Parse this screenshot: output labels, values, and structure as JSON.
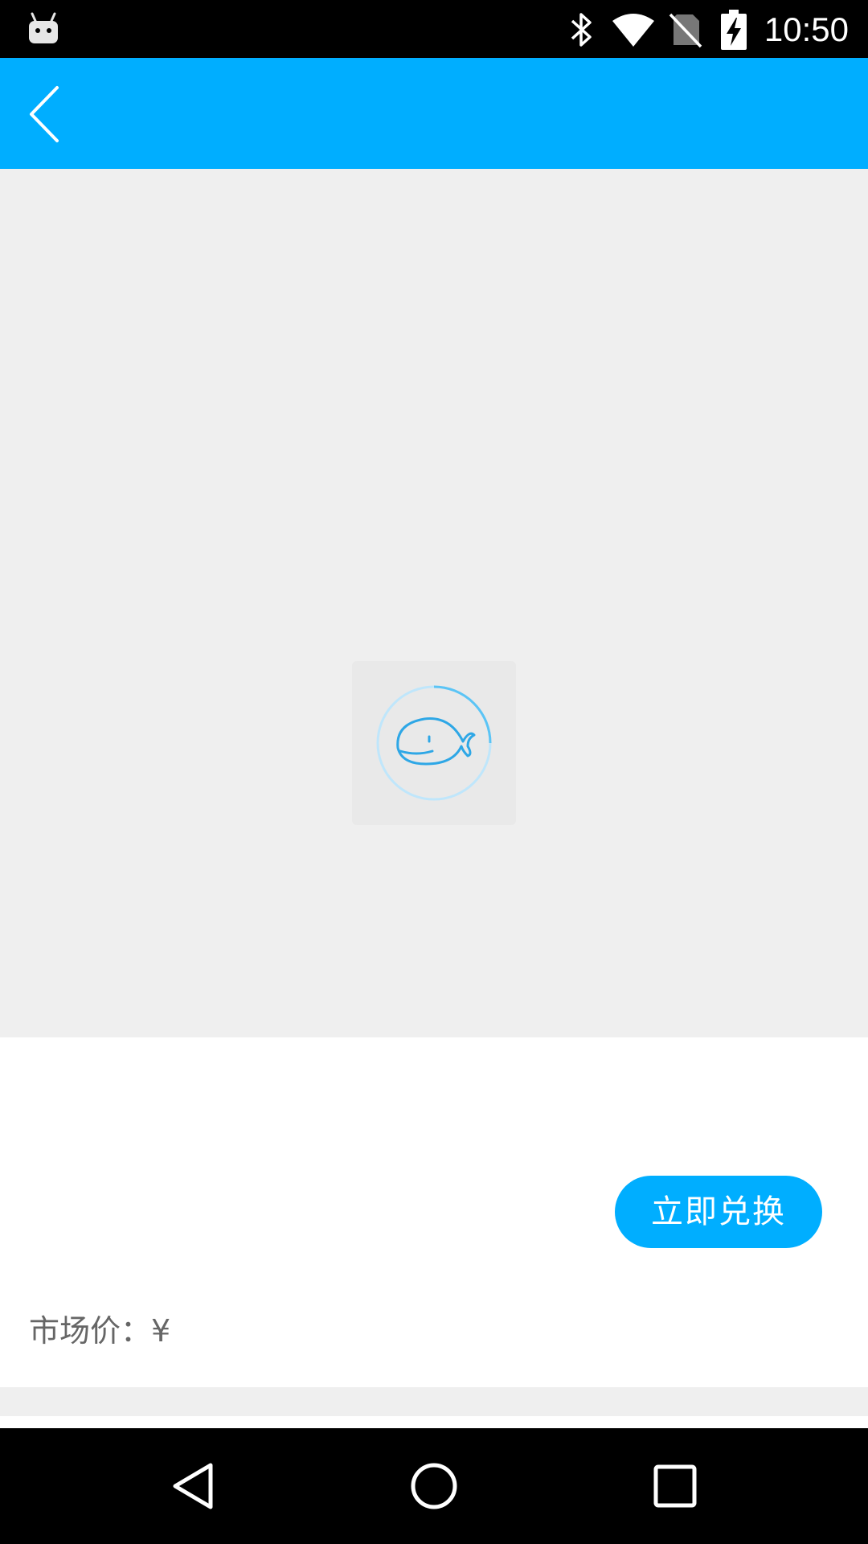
{
  "status_bar": {
    "time": "10:50",
    "icons": [
      "android-icon",
      "bluetooth-icon",
      "wifi-icon",
      "no-sim-icon",
      "battery-charging-icon"
    ]
  },
  "app_bar": {
    "back_icon": "chevron-left-icon",
    "background_color": "#00aeff"
  },
  "image_area": {
    "loading_icon": "whale-loading-spinner-icon"
  },
  "product": {
    "redeem_label": "立即兑换",
    "market_price_label": "市场价：¥"
  },
  "nav_bar": {
    "icons": [
      "nav-back-icon",
      "nav-home-icon",
      "nav-recent-icon"
    ]
  }
}
